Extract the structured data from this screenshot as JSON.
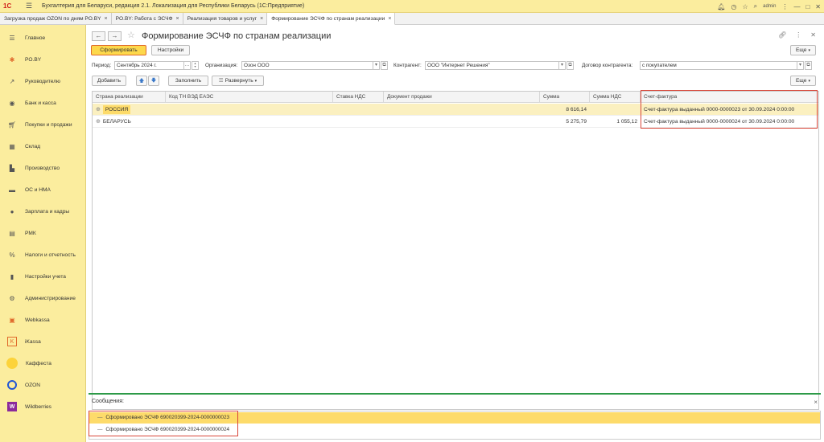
{
  "app": {
    "logo_text": "1С",
    "title": "Бухгалтерия для Беларуси, редакция 2.1. Локализация для Республики Беларусь   (1С:Предприятие)",
    "user": "admin"
  },
  "tabs": [
    {
      "label": "Загрузка продаж OZON по дням PO.BY"
    },
    {
      "label": "PO.BY: Работа с ЭСЧФ"
    },
    {
      "label": "Реализация товаров и услуг"
    },
    {
      "label": "Формирование ЭСЧФ по странам реализации"
    }
  ],
  "sidebar": {
    "items": [
      {
        "label": "Главное",
        "icon": "menu-icon"
      },
      {
        "label": "PO.BY",
        "icon": "po-by-icon"
      },
      {
        "label": "Руководителю",
        "icon": "chart-icon"
      },
      {
        "label": "Банк и касса",
        "icon": "bank-icon"
      },
      {
        "label": "Покупки и продажи",
        "icon": "cart-icon"
      },
      {
        "label": "Склад",
        "icon": "warehouse-icon"
      },
      {
        "label": "Производство",
        "icon": "factory-icon"
      },
      {
        "label": "ОС и НМА",
        "icon": "truck-icon"
      },
      {
        "label": "Зарплата и кадры",
        "icon": "person-icon"
      },
      {
        "label": "РМК",
        "icon": "register-icon"
      },
      {
        "label": "Налоги и отчетность",
        "icon": "tax-icon"
      },
      {
        "label": "Настройки учета",
        "icon": "settings-book-icon"
      },
      {
        "label": "Администрирование",
        "icon": "gear-icon"
      },
      {
        "label": "Webkassa",
        "icon": "webkassa-icon"
      },
      {
        "label": "iKassa",
        "icon": "ikassa-icon"
      },
      {
        "label": "Каффеста",
        "icon": "kaffesta-icon"
      },
      {
        "label": "OZON",
        "icon": "ozon-icon"
      },
      {
        "label": "Wildberries",
        "icon": "wildberries-icon"
      }
    ]
  },
  "form": {
    "title": "Формирование ЭСЧФ по странам реализации",
    "generate_label": "Сформировать",
    "settings_label": "Настройки",
    "more_label": "Еще",
    "period_label": "Период:",
    "period_value": "Сентябрь 2024 г.",
    "org_label": "Организация:",
    "org_value": "Озон ООО",
    "contractor_label": "Контрагент:",
    "contractor_value": "ООО \"Интернет Решения\"",
    "contract_label": "Договор контрагента:",
    "contract_value": "с покупателем",
    "add_label": "Добавить",
    "fill_label": "Заполнить",
    "expand_label": "Развернуть",
    "more2_label": "Еще"
  },
  "table": {
    "columns": [
      "Страна реализации",
      "Код ТН ВЭД ЕАЭС",
      "Ставка НДС",
      "Документ продажи",
      "Сумма",
      "Сумма НДС",
      "Счет-фактура"
    ],
    "rows": [
      {
        "country": "РОССИЯ",
        "code": "",
        "rate": "",
        "doc": "",
        "sum": "8 616,14",
        "vat": "",
        "invoice": "Счет-фактура выданный 0000-0000023 от 30.09.2024 0:00:00"
      },
      {
        "country": "БЕЛАРУСЬ",
        "code": "",
        "rate": "",
        "doc": "",
        "sum": "5 275,79",
        "vat": "1 055,12",
        "invoice": "Счет-фактура выданный 0000-0000024 от 30.09.2024 0:00:00"
      }
    ]
  },
  "messages": {
    "title": "Сообщения:",
    "items": [
      "Сформировано ЭСЧФ 690020399-2024-0000000023",
      "Сформировано ЭСЧФ 690020399-2024-0000000024"
    ]
  },
  "colors": {
    "accent_yellow": "#fbed9e",
    "highlight": "#fddb6a",
    "annotation_red": "#d9473a",
    "message_green": "#2d9a48"
  }
}
